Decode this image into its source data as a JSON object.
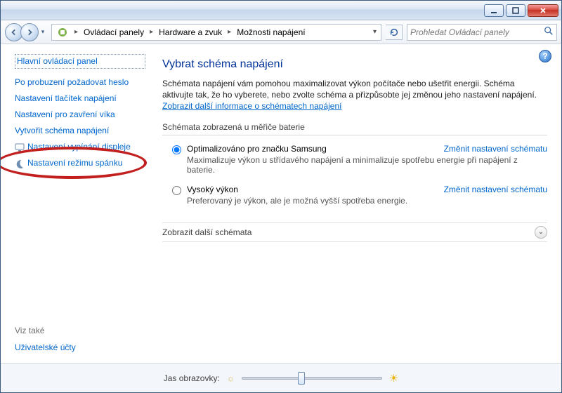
{
  "titlebar": {
    "min": "",
    "max": "",
    "close": ""
  },
  "breadcrumb": {
    "segments": [
      "Ovládací panely",
      "Hardware a zvuk",
      "Možnosti napájení"
    ]
  },
  "search": {
    "placeholder": "Prohledat Ovládací panely"
  },
  "sidebar": {
    "home": "Hlavní ovládací panel",
    "items": [
      "Po probuzení požadovat heslo",
      "Nastavení tlačítek napájení",
      "Nastavení pro zavření víka",
      "Vytvořit schéma napájení",
      "Nastavení vypínání displeje",
      "Nastavení režimu spánku"
    ],
    "see_also_label": "Viz také",
    "see_also_item": "Uživatelské účty"
  },
  "main": {
    "title": "Vybrat schéma napájení",
    "intro_a": "Schémata napájení vám pomohou maximalizovat výkon počítače nebo ušetřit energii. Schéma aktivujte tak, že ho vyberete, nebo zvolte schéma a přizpůsobte jej změnou jeho nastavení napájení. ",
    "intro_link": "Zobrazit další informace o schématech napájení",
    "section1_head": "Schémata zobrazená u měřiče baterie",
    "plans": [
      {
        "name": "Optimalizováno pro značku Samsung",
        "desc": "Maximalizuje výkon u střídavého napájení a minimalizuje spotřebu energie při napájení z baterie.",
        "link": "Změnit nastavení schématu",
        "checked": true
      },
      {
        "name": "Vysoký výkon",
        "desc": "Preferovaný je výkon, ale je možná vyšší spotřeba energie.",
        "link": "Změnit nastavení schématu",
        "checked": false
      }
    ],
    "expand": "Zobrazit další schémata"
  },
  "footer": {
    "brightness_label": "Jas obrazovky:"
  },
  "icons": {
    "help": "?",
    "chev_down": "⌄"
  }
}
